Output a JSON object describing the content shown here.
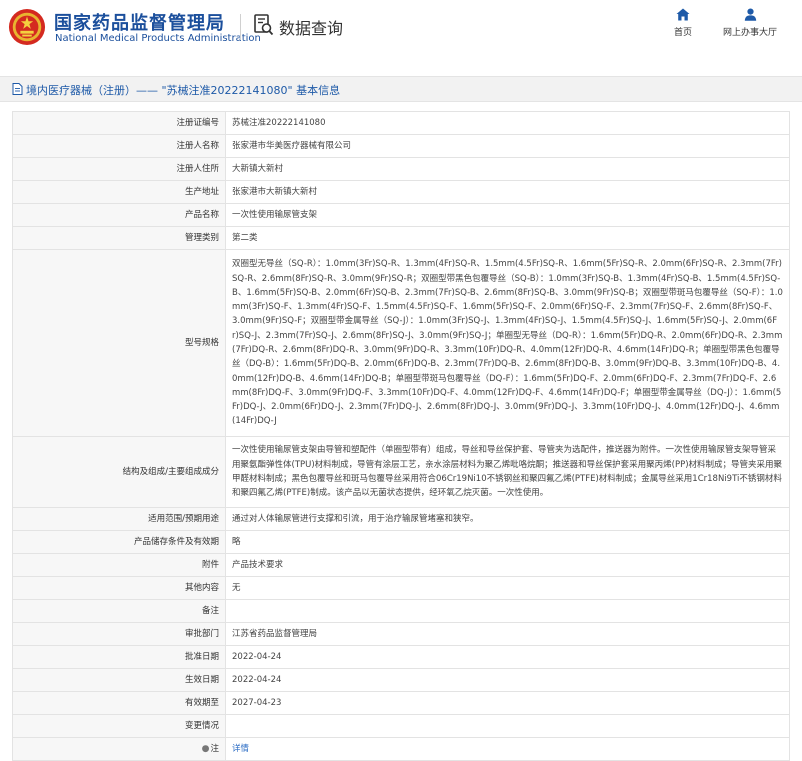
{
  "header": {
    "brand_cn": "国家药品监督管理局",
    "brand_en": "National Medical Products Administration",
    "query_title": "数据查询",
    "nav": [
      {
        "label": "首页",
        "icon": "home-icon"
      },
      {
        "label": "网上办事大厅",
        "icon": "user-icon"
      }
    ]
  },
  "breadcrumb": {
    "text": "境内医疗器械（注册）——  \"苏械注准20222141080\"  基本信息"
  },
  "colors": {
    "brand": "#1b4f9c",
    "link": "#2b6cc4",
    "crumb_bg": "#f2f2f2",
    "label_bg": "#f7f7f7"
  },
  "rows": [
    {
      "label": "注册证编号",
      "value": "苏械注准20222141080"
    },
    {
      "label": "注册人名称",
      "value": "张家港市华美医疗器械有限公司"
    },
    {
      "label": "注册人住所",
      "value": "大新镇大新村"
    },
    {
      "label": "生产地址",
      "value": "张家港市大新镇大新村"
    },
    {
      "label": "产品名称",
      "value": "一次性使用输尿管支架"
    },
    {
      "label": "管理类别",
      "value": "第二类"
    },
    {
      "label": "型号规格",
      "value": "双圈型无导丝（SQ-R）：1.0mm(3Fr)SQ-R、1.3mm(4Fr)SQ-R、1.5mm(4.5Fr)SQ-R、1.6mm(5Fr)SQ-R、2.0mm(6Fr)SQ-R、2.3mm(7Fr)SQ-R、2.6mm(8Fr)SQ-R、3.0mm(9Fr)SQ-R；双圈型带黑色包覆导丝（SQ-B）：1.0mm(3Fr)SQ-B、1.3mm(4Fr)SQ-B、1.5mm(4.5Fr)SQ-B、1.6mm(5Fr)SQ-B、2.0mm(6Fr)SQ-B、2.3mm(7Fr)SQ-B、2.6mm(8Fr)SQ-B、3.0mm(9Fr)SQ-B；双圈型带斑马包覆导丝（SQ-F）：1.0mm(3Fr)SQ-F、1.3mm(4Fr)SQ-F、1.5mm(4.5Fr)SQ-F、1.6mm(5Fr)SQ-F、2.0mm(6Fr)SQ-F、2.3mm(7Fr)SQ-F、2.6mm(8Fr)SQ-F、3.0mm(9Fr)SQ-F；双圈型带金属导丝（SQ-J）：1.0mm(3Fr)SQ-J、1.3mm(4Fr)SQ-J、1.5mm(4.5Fr)SQ-J、1.6mm(5Fr)SQ-J、2.0mm(6Fr)SQ-J、2.3mm(7Fr)SQ-J、2.6mm(8Fr)SQ-J、3.0mm(9Fr)SQ-J；单圈型无导丝（DQ-R）：1.6mm(5Fr)DQ-R、2.0mm(6Fr)DQ-R、2.3mm(7Fr)DQ-R、2.6mm(8Fr)DQ-R、3.0mm(9Fr)DQ-R、3.3mm(10Fr)DQ-R、4.0mm(12Fr)DQ-R、4.6mm(14Fr)DQ-R；单圈型带黑色包覆导丝（DQ-B）：1.6mm(5Fr)DQ-B、2.0mm(6Fr)DQ-B、2.3mm(7Fr)DQ-B、2.6mm(8Fr)DQ-B、3.0mm(9Fr)DQ-B、3.3mm(10Fr)DQ-B、4.0mm(12Fr)DQ-B、4.6mm(14Fr)DQ-B；单圈型带斑马包覆导丝（DQ-F）：1.6mm(5Fr)DQ-F、2.0mm(6Fr)DQ-F、2.3mm(7Fr)DQ-F、2.6mm(8Fr)DQ-F、3.0mm(9Fr)DQ-F、3.3mm(10Fr)DQ-F、4.0mm(12Fr)DQ-F、4.6mm(14Fr)DQ-F；单圈型带金属导丝（DQ-J）：1.6mm(5Fr)DQ-J、2.0mm(6Fr)DQ-J、2.3mm(7Fr)DQ-J、2.6mm(8Fr)DQ-J、3.0mm(9Fr)DQ-J、3.3mm(10Fr)DQ-J、4.0mm(12Fr)DQ-J、4.6mm(14Fr)DQ-J"
    },
    {
      "label": "结构及组成/主要组成成分",
      "value": "一次性使用输尿管支架由导管和塑配件（单圈型带有）组成，导丝和导丝保护套、导管夹为选配件，推送器为附件。一次性使用输尿管支架导管采用聚氨酯弹性体(TPU)材料制成，导管有涂层工艺，亲水涂层材料为聚乙烯吡咯烷酮；推送器和导丝保护套采用聚丙烯(PP)材料制成；导管夹采用聚甲醛材料制成；黑色包覆导丝和斑马包覆导丝采用符合06Cr19Ni10不锈钢丝和聚四氟乙烯(PTFE)材料制成；金属导丝采用1Cr18Ni9Ti不锈钢材料和聚四氟乙烯(PTFE)制成。该产品以无菌状态提供，经环氧乙烷灭菌。一次性使用。"
    },
    {
      "label": "适用范围/预期用途",
      "value": "通过对人体输尿管进行支撑和引流，用于治疗输尿管堵塞和狭窄。"
    },
    {
      "label": "产品储存条件及有效期",
      "value": "略"
    },
    {
      "label": "附件",
      "value": "产品技术要求"
    },
    {
      "label": "其他内容",
      "value": "无"
    },
    {
      "label": "备注",
      "value": ""
    },
    {
      "label": "审批部门",
      "value": "江苏省药品监督管理局"
    },
    {
      "label": "批准日期",
      "value": "2022-04-24"
    },
    {
      "label": "生效日期",
      "value": "2022-04-24"
    },
    {
      "label": "有效期至",
      "value": "2027-04-23"
    },
    {
      "label": "变更情况",
      "value": ""
    },
    {
      "label": "注",
      "value": "详情"
    }
  ]
}
